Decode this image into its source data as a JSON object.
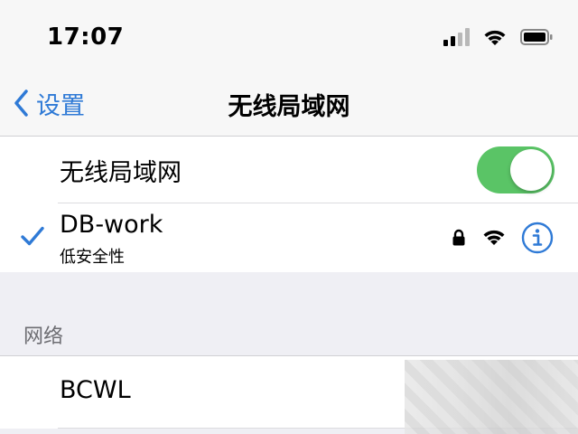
{
  "status_bar": {
    "time": "17:07",
    "signal_icon": "cellular-signal-icon",
    "wifi_icon": "wifi-icon",
    "battery_icon": "battery-icon"
  },
  "nav": {
    "back_label": "设置",
    "title": "无线局域网"
  },
  "wifi_toggle": {
    "label": "无线局域网",
    "on": true
  },
  "connected_network": {
    "name": "DB-work",
    "security_note": "低安全性",
    "lock_icon": "lock-icon",
    "wifi_icon": "wifi-icon",
    "info_icon": "info-icon"
  },
  "networks_section": {
    "header": "网络",
    "items": [
      {
        "name": "BCWL"
      }
    ]
  },
  "colors": {
    "accent": "#2f7ad6",
    "toggle_on": "#5ac466",
    "text": "#000000",
    "secondary_text": "#6d6d72",
    "background": "#efeff4"
  }
}
